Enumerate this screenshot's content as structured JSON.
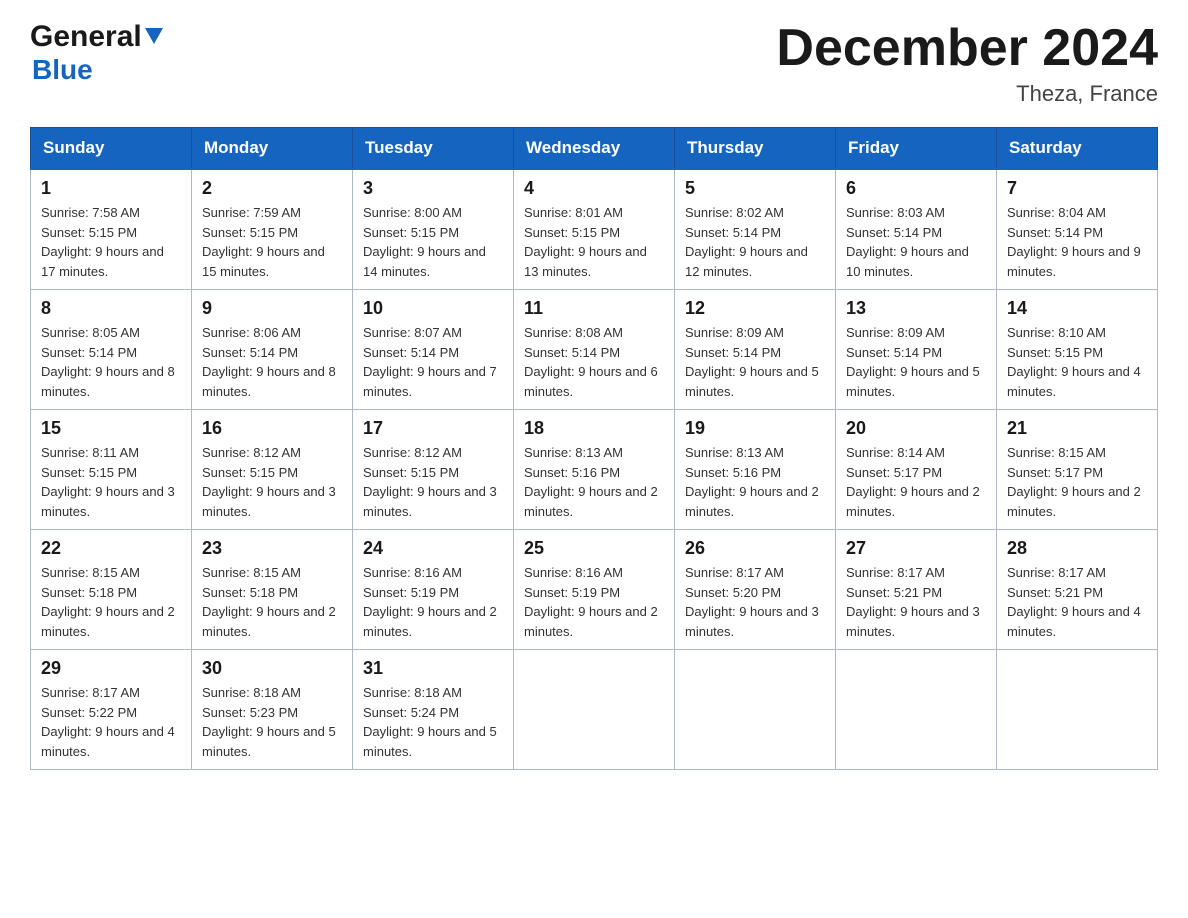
{
  "header": {
    "logo_line1": "General",
    "logo_line2": "Blue",
    "title": "December 2024",
    "location": "Theza, France"
  },
  "calendar": {
    "days_of_week": [
      "Sunday",
      "Monday",
      "Tuesday",
      "Wednesday",
      "Thursday",
      "Friday",
      "Saturday"
    ],
    "weeks": [
      [
        {
          "day": "1",
          "sunrise": "7:58 AM",
          "sunset": "5:15 PM",
          "daylight": "9 hours and 17 minutes."
        },
        {
          "day": "2",
          "sunrise": "7:59 AM",
          "sunset": "5:15 PM",
          "daylight": "9 hours and 15 minutes."
        },
        {
          "day": "3",
          "sunrise": "8:00 AM",
          "sunset": "5:15 PM",
          "daylight": "9 hours and 14 minutes."
        },
        {
          "day": "4",
          "sunrise": "8:01 AM",
          "sunset": "5:15 PM",
          "daylight": "9 hours and 13 minutes."
        },
        {
          "day": "5",
          "sunrise": "8:02 AM",
          "sunset": "5:14 PM",
          "daylight": "9 hours and 12 minutes."
        },
        {
          "day": "6",
          "sunrise": "8:03 AM",
          "sunset": "5:14 PM",
          "daylight": "9 hours and 10 minutes."
        },
        {
          "day": "7",
          "sunrise": "8:04 AM",
          "sunset": "5:14 PM",
          "daylight": "9 hours and 9 minutes."
        }
      ],
      [
        {
          "day": "8",
          "sunrise": "8:05 AM",
          "sunset": "5:14 PM",
          "daylight": "9 hours and 8 minutes."
        },
        {
          "day": "9",
          "sunrise": "8:06 AM",
          "sunset": "5:14 PM",
          "daylight": "9 hours and 8 minutes."
        },
        {
          "day": "10",
          "sunrise": "8:07 AM",
          "sunset": "5:14 PM",
          "daylight": "9 hours and 7 minutes."
        },
        {
          "day": "11",
          "sunrise": "8:08 AM",
          "sunset": "5:14 PM",
          "daylight": "9 hours and 6 minutes."
        },
        {
          "day": "12",
          "sunrise": "8:09 AM",
          "sunset": "5:14 PM",
          "daylight": "9 hours and 5 minutes."
        },
        {
          "day": "13",
          "sunrise": "8:09 AM",
          "sunset": "5:14 PM",
          "daylight": "9 hours and 5 minutes."
        },
        {
          "day": "14",
          "sunrise": "8:10 AM",
          "sunset": "5:15 PM",
          "daylight": "9 hours and 4 minutes."
        }
      ],
      [
        {
          "day": "15",
          "sunrise": "8:11 AM",
          "sunset": "5:15 PM",
          "daylight": "9 hours and 3 minutes."
        },
        {
          "day": "16",
          "sunrise": "8:12 AM",
          "sunset": "5:15 PM",
          "daylight": "9 hours and 3 minutes."
        },
        {
          "day": "17",
          "sunrise": "8:12 AM",
          "sunset": "5:15 PM",
          "daylight": "9 hours and 3 minutes."
        },
        {
          "day": "18",
          "sunrise": "8:13 AM",
          "sunset": "5:16 PM",
          "daylight": "9 hours and 2 minutes."
        },
        {
          "day": "19",
          "sunrise": "8:13 AM",
          "sunset": "5:16 PM",
          "daylight": "9 hours and 2 minutes."
        },
        {
          "day": "20",
          "sunrise": "8:14 AM",
          "sunset": "5:17 PM",
          "daylight": "9 hours and 2 minutes."
        },
        {
          "day": "21",
          "sunrise": "8:15 AM",
          "sunset": "5:17 PM",
          "daylight": "9 hours and 2 minutes."
        }
      ],
      [
        {
          "day": "22",
          "sunrise": "8:15 AM",
          "sunset": "5:18 PM",
          "daylight": "9 hours and 2 minutes."
        },
        {
          "day": "23",
          "sunrise": "8:15 AM",
          "sunset": "5:18 PM",
          "daylight": "9 hours and 2 minutes."
        },
        {
          "day": "24",
          "sunrise": "8:16 AM",
          "sunset": "5:19 PM",
          "daylight": "9 hours and 2 minutes."
        },
        {
          "day": "25",
          "sunrise": "8:16 AM",
          "sunset": "5:19 PM",
          "daylight": "9 hours and 2 minutes."
        },
        {
          "day": "26",
          "sunrise": "8:17 AM",
          "sunset": "5:20 PM",
          "daylight": "9 hours and 3 minutes."
        },
        {
          "day": "27",
          "sunrise": "8:17 AM",
          "sunset": "5:21 PM",
          "daylight": "9 hours and 3 minutes."
        },
        {
          "day": "28",
          "sunrise": "8:17 AM",
          "sunset": "5:21 PM",
          "daylight": "9 hours and 4 minutes."
        }
      ],
      [
        {
          "day": "29",
          "sunrise": "8:17 AM",
          "sunset": "5:22 PM",
          "daylight": "9 hours and 4 minutes."
        },
        {
          "day": "30",
          "sunrise": "8:18 AM",
          "sunset": "5:23 PM",
          "daylight": "9 hours and 5 minutes."
        },
        {
          "day": "31",
          "sunrise": "8:18 AM",
          "sunset": "5:24 PM",
          "daylight": "9 hours and 5 minutes."
        },
        null,
        null,
        null,
        null
      ]
    ]
  }
}
